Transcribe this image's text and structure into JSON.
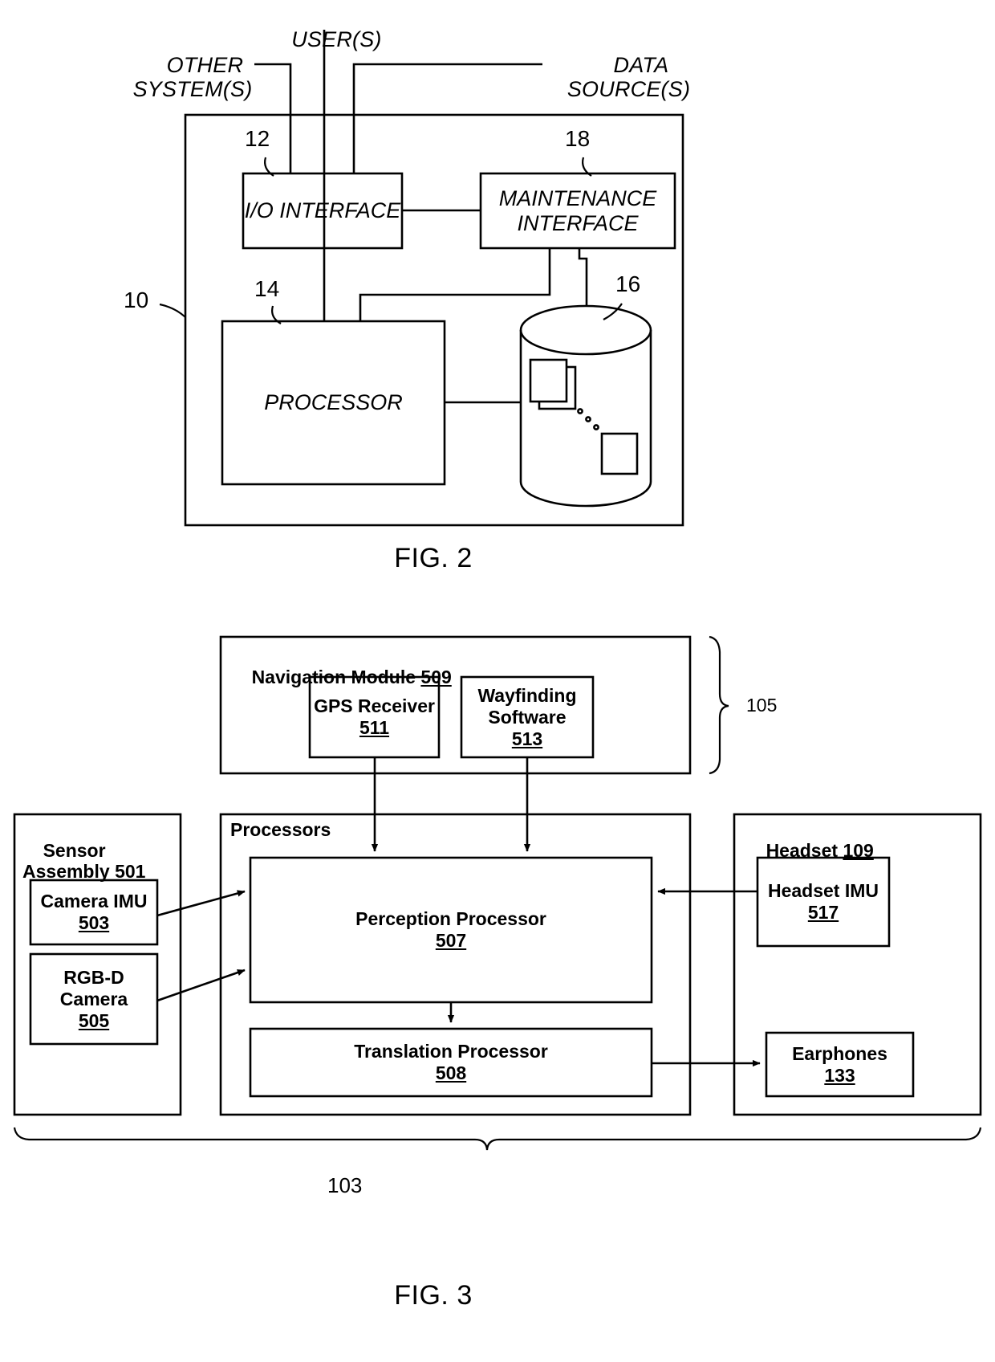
{
  "figure2": {
    "title": "FIG. 2",
    "system_ref": "10",
    "external_labels": [
      {
        "id": "other-systems",
        "text": "OTHER\nSYSTEM(S)"
      },
      {
        "id": "users",
        "text": "USER(S)"
      },
      {
        "id": "data-sources",
        "text": "DATA\nSOURCE(S)"
      }
    ],
    "blocks": [
      {
        "id": "io-interface",
        "label": "I/O\nINTERFACE",
        "ref": "12"
      },
      {
        "id": "maintenance-interface",
        "label": "MAINTENANCE\nINTERFACE",
        "ref": "18"
      },
      {
        "id": "processor",
        "label": "PROCESSOR",
        "ref": "14"
      },
      {
        "id": "database",
        "label": "",
        "ref": "16"
      }
    ]
  },
  "figure3": {
    "title": "FIG. 3",
    "bracket_right_ref": "105",
    "bracket_bottom_ref": "103",
    "navigation_module": {
      "title": "Navigation Module",
      "ref": "509",
      "children": [
        {
          "id": "gps-receiver",
          "label": "GPS\nReceiver",
          "ref": "511"
        },
        {
          "id": "wayfinding-software",
          "label": "Wayfinding\nSoftware",
          "ref": "513"
        }
      ]
    },
    "sensor_assembly": {
      "title": "Sensor\nAssembly",
      "ref": "501",
      "children": [
        {
          "id": "camera-imu",
          "label": "Camera\nIMU",
          "ref": "503",
          "inline_ref": true
        },
        {
          "id": "rgbd-camera",
          "label": "RGB-D\nCamera",
          "ref": "505",
          "inline_ref": false
        }
      ]
    },
    "processors": {
      "title": "Processors",
      "children": [
        {
          "id": "perception-processor",
          "label": "Perception Processor",
          "ref": "507"
        },
        {
          "id": "translation-processor",
          "label": "Translation Processor",
          "ref": "508"
        }
      ]
    },
    "headset": {
      "title": "Headset",
      "ref": "109",
      "children": [
        {
          "id": "headset-imu",
          "label": "Headset\nIMU",
          "ref": "517"
        },
        {
          "id": "earphones",
          "label": "Earphones",
          "ref": "133"
        }
      ]
    }
  },
  "colors": {
    "ink": "#000000",
    "paper": "#ffffff"
  }
}
